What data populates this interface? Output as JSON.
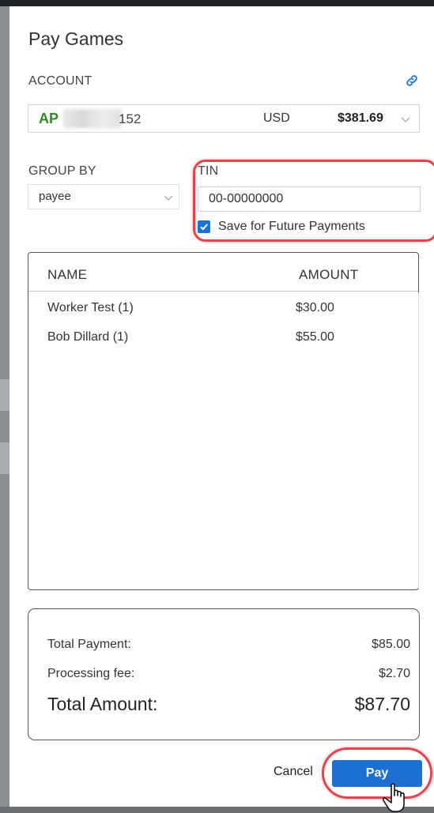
{
  "dialog": {
    "title": "Pay Games"
  },
  "account": {
    "label": "ACCOUNT",
    "prefix": "AP",
    "suffix": "152",
    "currency": "USD",
    "balance": "$381.69",
    "link_icon": "link-icon",
    "dropdown_icon": "chevron-down-icon"
  },
  "group_by": {
    "label": "GROUP BY",
    "value": "payee",
    "dropdown_icon": "chevron-down-icon"
  },
  "tin": {
    "label": "TIN",
    "value": "00-00000000",
    "save_checked": true,
    "save_label": "Save for Future Payments"
  },
  "table": {
    "headers": [
      "NAME",
      "AMOUNT"
    ],
    "rows": [
      {
        "name": "Worker Test (1)",
        "amount": "$30.00"
      },
      {
        "name": "Bob Dillard (1)",
        "amount": "$55.00"
      }
    ]
  },
  "summary": {
    "total_payment_label": "Total Payment:",
    "total_payment": "$85.00",
    "fee_label": "Processing fee:",
    "fee": "$2.70",
    "total_amount_label": "Total Amount:",
    "total_amount": "$87.70"
  },
  "actions": {
    "cancel": "Cancel",
    "pay": "Pay"
  },
  "colors": {
    "accent": "#1d6fd1",
    "account_prefix": "#2e8b1f",
    "annotation": "#e8434b"
  }
}
